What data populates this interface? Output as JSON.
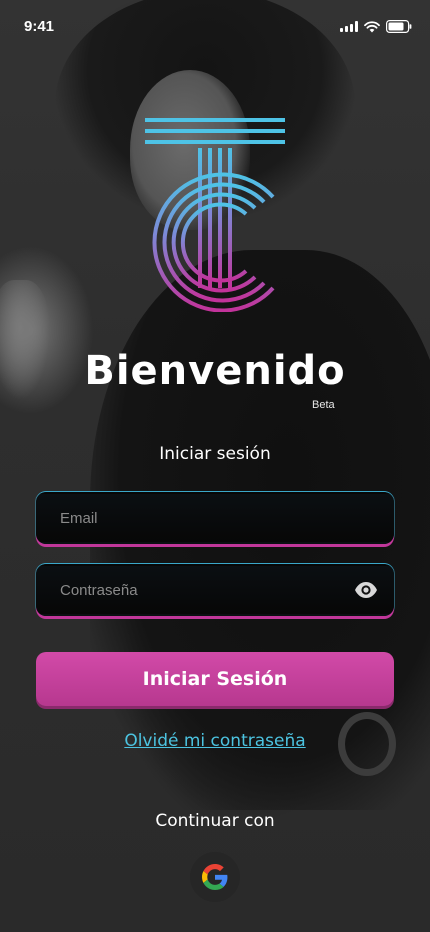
{
  "status_bar": {
    "time": "9:41"
  },
  "header": {
    "title": "Bienvenido",
    "badge": "Beta"
  },
  "login": {
    "heading": "Iniciar sesión",
    "email_placeholder": "Email",
    "password_placeholder": "Contraseña",
    "submit_label": "Iniciar Sesión",
    "forgot_label": "Olvidé mi contraseña"
  },
  "social": {
    "label": "Continuar con",
    "providers": [
      "google"
    ]
  },
  "icons": {
    "logo": "tc-logo-icon",
    "eye": "eye-icon",
    "google": "google-icon",
    "signal": "cellular-signal-icon",
    "wifi": "wifi-icon",
    "battery": "battery-icon"
  },
  "colors": {
    "accent_pink": "#c1379a",
    "accent_cyan": "#4cc3e0",
    "logo_cyan": "#4ec3e6",
    "logo_magenta": "#c2339a"
  }
}
